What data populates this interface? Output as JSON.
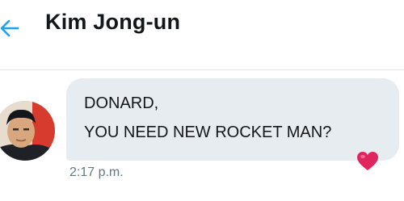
{
  "header": {
    "back_icon": "arrow-left-icon",
    "title": "Kim Jong-un"
  },
  "conversation": {
    "avatar_icon": "contact-avatar",
    "message": {
      "line1": "DONARD,",
      "line2": "YOU NEED NEW ROCKET MAN?",
      "timestamp": "2:17 p.m.",
      "reaction": "heart-icon"
    }
  },
  "colors": {
    "accent": "#1da1f2",
    "bubble": "#e6ecf0",
    "text": "#14171a",
    "muted": "#657786",
    "heart": "#e0245e"
  }
}
